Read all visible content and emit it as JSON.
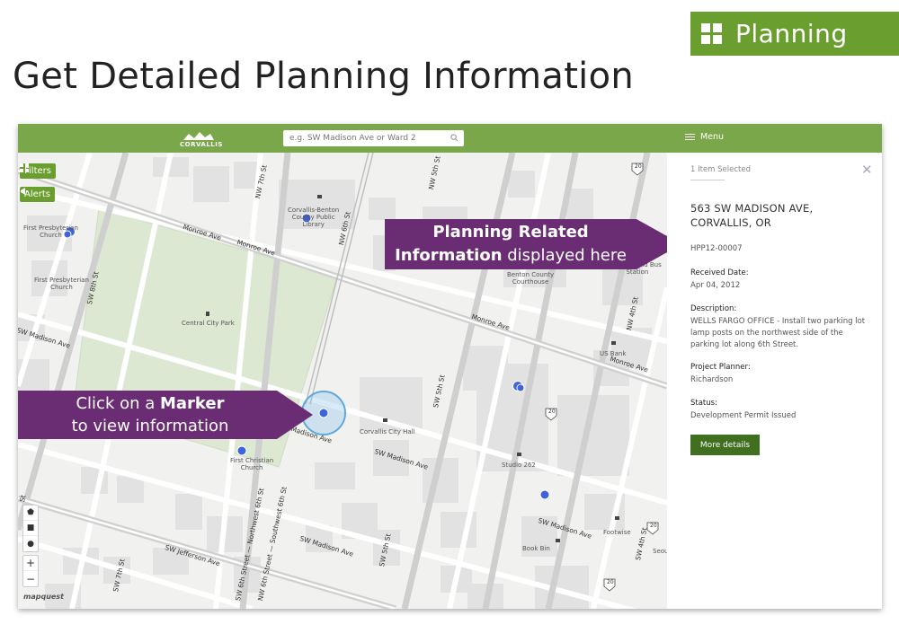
{
  "badge": {
    "label": "Planning",
    "color": "#6a9f2f"
  },
  "title": "Get Detailed Planning Information",
  "app": {
    "logo_text": "CORVALLIS",
    "search": {
      "placeholder": "e.g. SW Madison Ave or Ward 2",
      "icon": "search-icon"
    },
    "menu_label": "Menu",
    "map_buttons": {
      "filters": "Filters",
      "alerts": "Alerts"
    },
    "draw_tools": [
      "⬟",
      "■",
      "●"
    ],
    "zoom": {
      "in": "+",
      "out": "−"
    },
    "mapquest": "mapquest",
    "places": {
      "library": "Corvallis-Benton\nCounty Public\nLibrary",
      "presby1": "First Presbyterian\nChurch",
      "presby2": "First Presbyterian\nChurch",
      "park": "Central City Park",
      "courthouse": "Benton County\nCourthouse",
      "greyhound": "Greyhound Bus\nStation",
      "usbank": "US Bank",
      "cityhall": "Corvallis City Hall",
      "christian": "First Christian\nChurch",
      "studio": "Studio 262",
      "footwise": "Footwise",
      "bookbin": "Book Bin",
      "seou": "Seou"
    },
    "streets": {
      "monroe1": "Monroe Ave",
      "monroe2": "Monroe Ave",
      "monroe3": "Monroe Ave",
      "monroe4": "Monroe Ave",
      "madison1": "SW Madison Ave",
      "madison2": "SW Madison Ave",
      "madison3": "Madison Ave",
      "madison4": "SW Madison Ave",
      "madison5": "SW Madison Ave",
      "jefferson": "SW Jefferson Ave",
      "nw7": "NW 7th St",
      "nw6": "NW 6th St",
      "nw5": "NW 5th St",
      "sw8": "SW 8th St",
      "sw7": "SW 7th St",
      "sw6a": "SW 6th Street — Northwest 6th St",
      "sw6b": "NW 6th Street — Southwest 6th St",
      "sw5": "SW 5th St",
      "sw5b": "SW 5th St",
      "nw4": "NW 4th St",
      "sw4": "SW 4th St",
      "s": "St",
      "r20a": "20",
      "r20b": "20",
      "r20c": "20",
      "r20d": "20"
    },
    "callouts": {
      "top_bold": "Planning Related",
      "top_bold2": "Information",
      "top_rest": " displayed here",
      "left_pre": "Click on a ",
      "left_bold": "Marker",
      "left_rest": "to view information"
    },
    "sidebar": {
      "selected": "1 Item Selected",
      "close": "✕",
      "address_line1": "563 SW MADISON AVE,",
      "address_line2": "CORVALLIS, OR",
      "permit_id": "HPP12-00007",
      "received_label": "Received Date:",
      "received_value": "Apr 04, 2012",
      "description_label": "Description:",
      "description_value": "WELLS FARGO OFFICE - Install two parking lot lamp posts on the northwest side of the parking lot along 6th Street.",
      "planner_label": "Project Planner:",
      "planner_value": "Richardson",
      "status_label": "Status:",
      "status_value": "Development Permit Issued",
      "button": "More details"
    }
  }
}
